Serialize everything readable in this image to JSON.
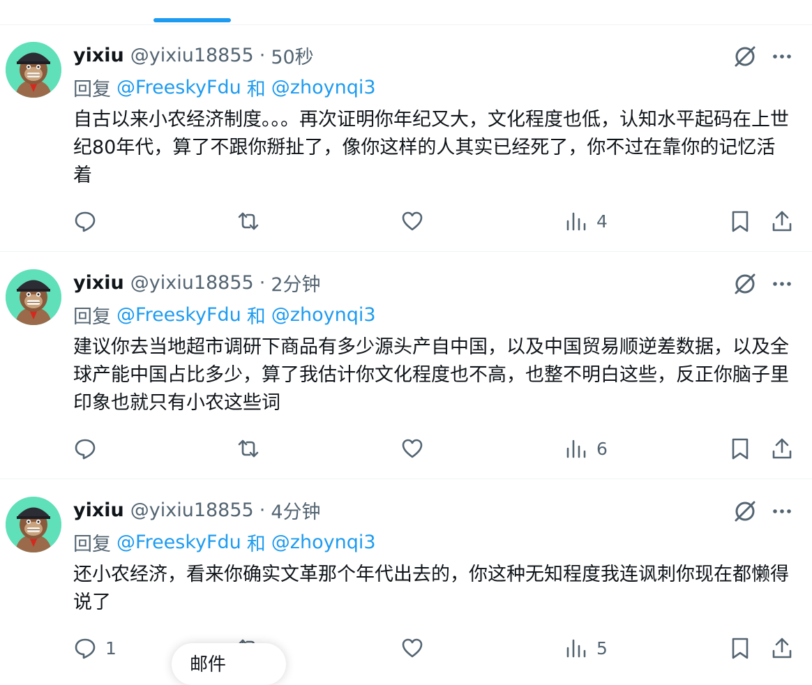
{
  "tweets": [
    {
      "display_name": "yixiu",
      "handle": "@yixiu18855",
      "separator": "·",
      "time": "50秒",
      "reply_prefix": "回复",
      "mentions": [
        "@FreeskyFdu",
        "@zhoynqi3"
      ],
      "and_word": "和",
      "text": "自古以来小农经济制度。。。再次证明你年纪又大，文化程度也低，认知水平起码在上世纪80年代，算了不跟你掰扯了，像你这样的人其实已经死了，你不过在靠你的记忆活着",
      "reply_count": "",
      "views": "4"
    },
    {
      "display_name": "yixiu",
      "handle": "@yixiu18855",
      "separator": "·",
      "time": "2分钟",
      "reply_prefix": "回复",
      "mentions": [
        "@FreeskyFdu",
        "@zhoynqi3"
      ],
      "and_word": "和",
      "text": "建议你去当地超市调研下商品有多少源头产自中国，以及中国贸易顺逆差数据，以及全球产能中国占比多少，算了我估计你文化程度也不高，也整不明白这些，反正你脑子里印象也就只有小农这些词",
      "reply_count": "",
      "views": "6"
    },
    {
      "display_name": "yixiu",
      "handle": "@yixiu18855",
      "separator": "·",
      "time": "4分钟",
      "reply_prefix": "回复",
      "mentions": [
        "@FreeskyFdu",
        "@zhoynqi3"
      ],
      "and_word": "和",
      "text": "还小农经济，看来你确实文革那个年代出去的，你这种无知程度我连讽刺你现在都懒得说了",
      "reply_count": "1",
      "views": "5"
    }
  ],
  "bottom_pill": {
    "label": "邮件"
  },
  "icons": {
    "reply": "reply-icon",
    "retweet": "retweet-icon",
    "like": "heart-icon",
    "views": "views-icon",
    "bookmark": "bookmark-icon",
    "share": "share-icon",
    "grok": "grok-icon",
    "more": "more-icon"
  },
  "colors": {
    "accent": "#1d9bf0",
    "secondary_text": "#536471",
    "primary_text": "#0f1419",
    "avatar_bg": "#5fe0b8",
    "divider": "#eff3f4"
  }
}
